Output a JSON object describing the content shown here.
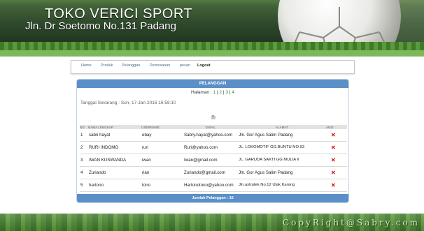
{
  "header": {
    "title": "TOKO VERICI SPORT",
    "address": "Jln. Dr Soetomo No.131 Padang"
  },
  "nav": {
    "items": [
      {
        "label": "Home"
      },
      {
        "label": "Produk"
      },
      {
        "label": "Pelanggan"
      },
      {
        "label": "Pemesanan"
      },
      {
        "label": "pesan"
      },
      {
        "label": "Logout"
      }
    ]
  },
  "panel": {
    "title": "PELANGGAN",
    "halaman_label": "Halaman :",
    "pages": [
      "1",
      "2",
      "3",
      "4"
    ],
    "sep": "|",
    "date_label": "Tanggal Sekarang : Sun, 17-Jan-2016 16:58:10",
    "footer": "Jumlah Pelanggan : 16"
  },
  "table": {
    "headers": [
      "NO",
      "NAMA LENGKAP",
      "USERNAME",
      "EMAIL",
      "ALAMAT",
      "AKSI"
    ],
    "rows": [
      {
        "no": "1",
        "nama": "sabri hayat",
        "username": "ebay",
        "email": "Sabry.hayat@yahoo.com",
        "alamat": "Jln. Gor Agus Salim Padang"
      },
      {
        "no": "2",
        "nama": "RURI INDOMO",
        "username": "ruri",
        "email": "Ruri@yahoo.com",
        "alamat": "JL. LOKOMOTIF GG.BUNTU NO.93"
      },
      {
        "no": "3",
        "nama": "IWAN KUSWANDA",
        "username": "iwan",
        "email": "Iwan@gmail.com",
        "alamat": "JL. GARUDA SAKTI GG MULIA II"
      },
      {
        "no": "4",
        "nama": "Zuriando",
        "username": "rian",
        "email": "Zuriando@gmail.com",
        "alamat": "Jln. Gor Agus Salim Padang"
      },
      {
        "no": "5",
        "nama": "hartono",
        "username": "tono",
        "email": "Hartonotono@yahoo.com",
        "alamat": "Jln.astratek No.12 Ulak Karang"
      }
    ],
    "delete_icon": "x-icon"
  },
  "footer": {
    "copyright": "CopyRight@Sabry.com"
  },
  "colors": {
    "panel_header": "#5b8fc7",
    "page_link": "#2d8a2d",
    "delete": "#d40000"
  }
}
